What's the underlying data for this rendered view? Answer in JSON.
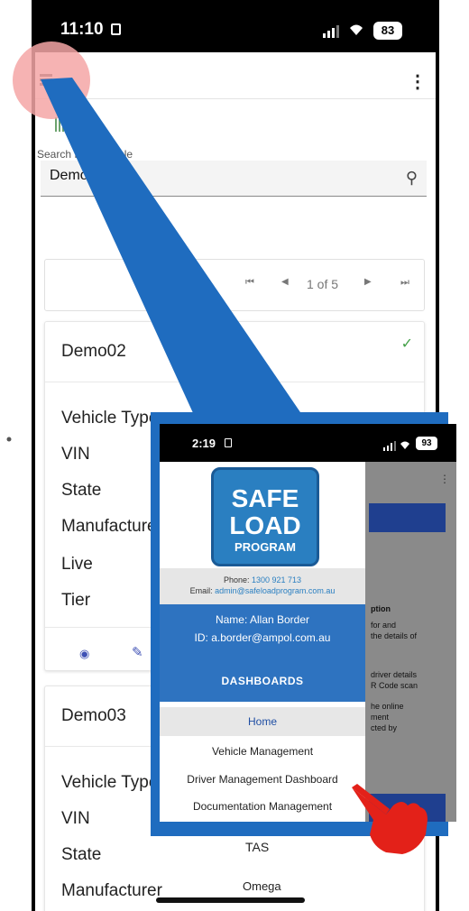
{
  "status_bar": {
    "time": "11:10",
    "battery": "83"
  },
  "search": {
    "label": "Search for a vehicle",
    "value": "Demo"
  },
  "pagination": {
    "page_text": "1 of 5"
  },
  "cards": [
    {
      "title": "Demo02",
      "fields": [
        "Vehicle Type",
        "VIN",
        "State",
        "Manufacturer",
        "Live",
        "Tier"
      ]
    },
    {
      "title": "Demo03",
      "fields": [
        "Vehicle Type",
        "VIN",
        "State",
        "Manufacturer"
      ],
      "values": [
        "TAS",
        "Omega"
      ]
    }
  ],
  "inset": {
    "status_time": "2:19",
    "battery": "93",
    "logo": {
      "line1": "SAFE",
      "line2": "LOAD",
      "line3": "PROGRAM"
    },
    "phone_label": "Phone:",
    "phone": "1300 921 713",
    "email_label": "Email:",
    "email": "admin@safeloadprogram.com.au",
    "name": "Name: Allan Border",
    "user_id": "ID: a.border@ampol.com.au",
    "dashboards": "DASHBOARDS",
    "menu": [
      "Home",
      "Vehicle Management",
      "Driver Management Dashboard",
      "Documentation Management"
    ],
    "background_text": [
      "ption",
      "for and",
      "the details of",
      "driver details",
      "R Code scan",
      "he online",
      "ment",
      "cted by"
    ]
  },
  "colors": {
    "accent": "#1f6cbf",
    "check": "#43a047",
    "highlight": "#f4a6a6",
    "hand": "#e32119"
  }
}
